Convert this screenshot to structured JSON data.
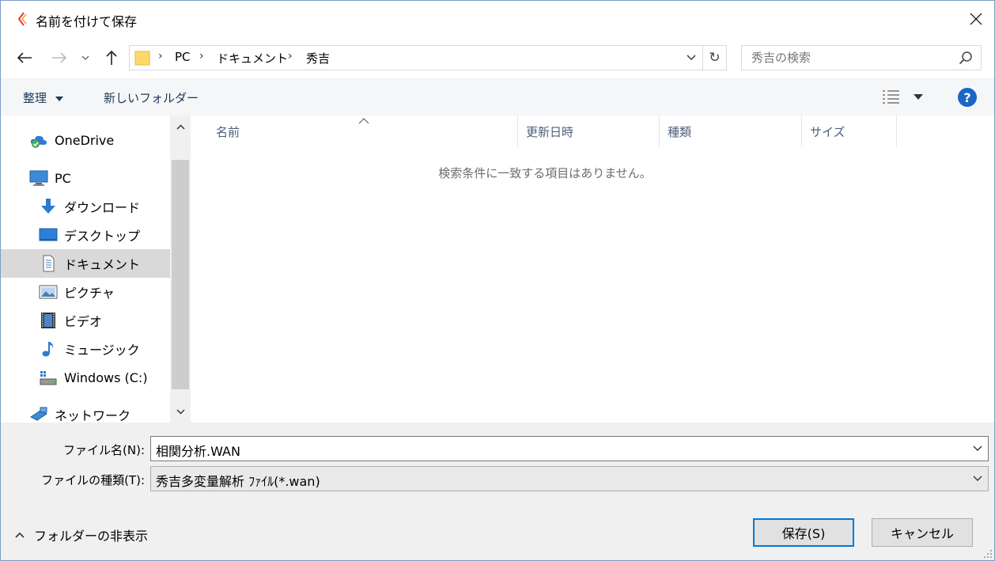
{
  "window": {
    "title": "名前を付けて保存",
    "close_icon": "close-icon",
    "accent": "#0078d7"
  },
  "nav": {
    "back_icon": "arrow-left-icon",
    "forward_icon": "arrow-right-icon",
    "recent_icon": "chevron-down-icon",
    "up_icon": "arrow-up-icon",
    "breadcrumbs": [
      "PC",
      "ドキュメント",
      "秀吉"
    ],
    "search_placeholder": "秀吉の検索"
  },
  "commands": {
    "organize": "整理",
    "new_folder": "新しいフォルダー",
    "help": "?"
  },
  "sidebar": {
    "items": [
      {
        "label": "OneDrive",
        "icon": "cloud-icon"
      },
      {
        "label": "PC",
        "icon": "computer-icon"
      },
      {
        "label": "ダウンロード",
        "icon": "download-icon"
      },
      {
        "label": "デスクトップ",
        "icon": "desktop-icon"
      },
      {
        "label": "ドキュメント",
        "icon": "document-icon",
        "selected": true
      },
      {
        "label": "ピクチャ",
        "icon": "picture-icon"
      },
      {
        "label": "ビデオ",
        "icon": "video-icon"
      },
      {
        "label": "ミュージック",
        "icon": "music-icon"
      },
      {
        "label": "Windows (C:)",
        "icon": "drive-icon"
      },
      {
        "label": "ネットワーク",
        "icon": "network-icon"
      }
    ]
  },
  "content": {
    "columns": [
      "名前",
      "更新日時",
      "種類",
      "サイズ"
    ],
    "empty_message": "検索条件に一致する項目はありません。"
  },
  "form": {
    "filename_label": "ファイル名(N):",
    "filename_value": "相関分析.WAN",
    "filetype_label": "ファイルの種類(T):",
    "filetype_value": "秀吉多変量解析 ﾌｧｲﾙ(*.wan)"
  },
  "footer": {
    "hide_folders": "フォルダーの非表示",
    "save": "保存(S)",
    "cancel": "キャンセル"
  }
}
